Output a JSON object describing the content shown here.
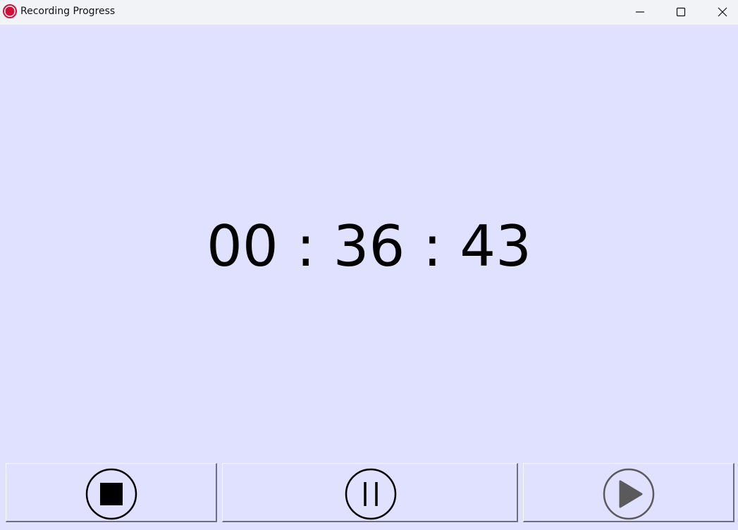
{
  "window": {
    "title": "Recording Progress",
    "accent_color": "#d0103a",
    "background_color": "#e0e0ff",
    "controls": {
      "minimize_icon": "minimize-icon",
      "maximize_icon": "maximize-icon",
      "close_icon": "close-icon"
    }
  },
  "timer": {
    "display": "00 : 36 : 43",
    "hours": "00",
    "minutes": "36",
    "seconds": "43"
  },
  "buttons": {
    "stop": {
      "icon": "stop-icon",
      "enabled": true
    },
    "pause": {
      "icon": "pause-icon",
      "enabled": true
    },
    "play": {
      "icon": "play-icon",
      "enabled": false
    }
  }
}
